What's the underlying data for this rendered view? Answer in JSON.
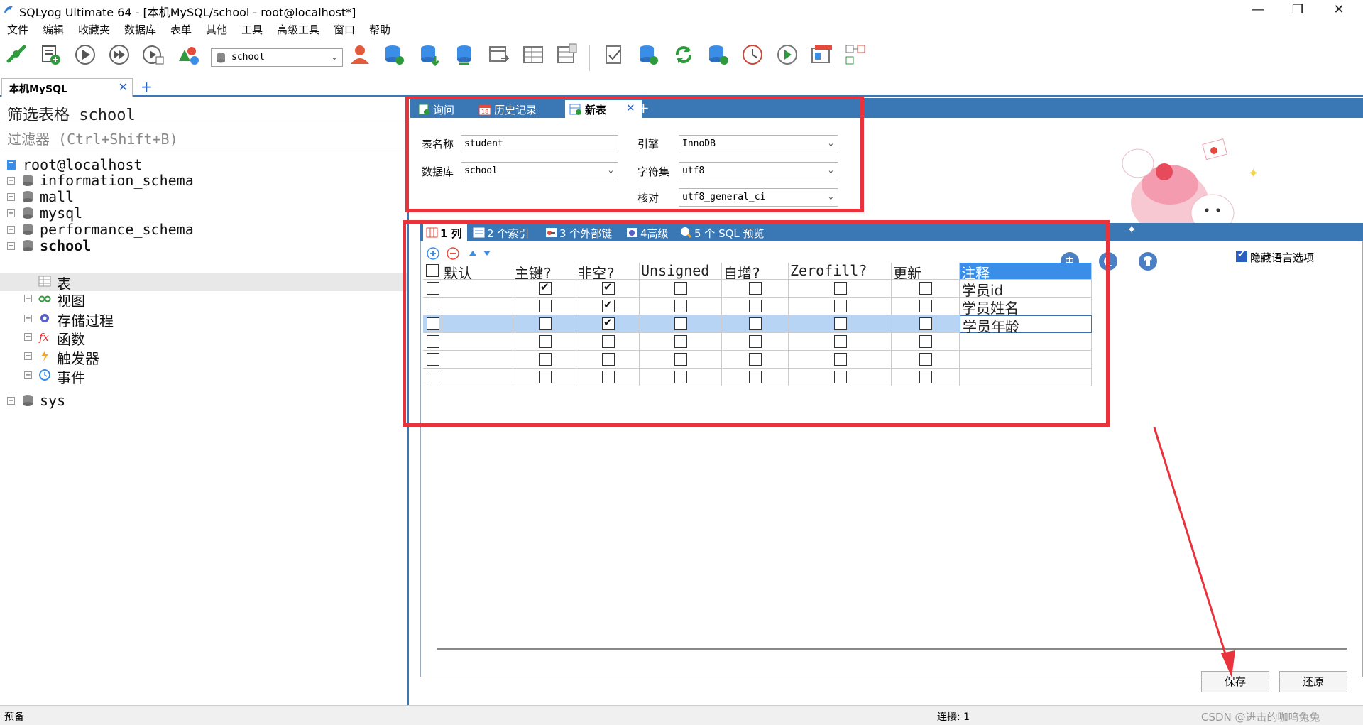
{
  "window": {
    "title": "SQLyog Ultimate 64 - [本机MySQL/school - root@localhost*]",
    "minimize": "—",
    "restore": "❐",
    "close": "✕"
  },
  "menu": [
    "文件",
    "编辑",
    "收藏夹",
    "数据库",
    "表单",
    "其他",
    "工具",
    "高级工具",
    "窗口",
    "帮助"
  ],
  "toolbar": {
    "database_select": "school"
  },
  "connection_tab": {
    "label": "本机MySQL",
    "close": "✕",
    "add": "+"
  },
  "object_browser": {
    "filter_label": "筛选表格 school",
    "filter_hint": "过滤器 (Ctrl+Shift+B)",
    "root": "root@localhost",
    "databases": [
      "information_schema",
      "mall",
      "mysql",
      "performance_schema",
      "school",
      "sys"
    ],
    "school_children": [
      "表",
      "视图",
      "存储过程",
      "函数",
      "触发器",
      "事件"
    ]
  },
  "doc_tabs": {
    "query": "询问",
    "history": "历史记录",
    "new_table": "新表",
    "close": "✕",
    "add": "+"
  },
  "table_form": {
    "name_label": "表名称",
    "name_value": "student",
    "db_label": "数据库",
    "db_value": "school",
    "engine_label": "引擎",
    "engine_value": "InnoDB",
    "charset_label": "字符集",
    "charset_value": "utf8",
    "collation_label": "核对",
    "collation_value": "utf8_general_ci"
  },
  "sub_tabs": {
    "columns": "1 列",
    "indexes": "2 个索引",
    "foreign_keys": "3 个外部键",
    "advanced": "4高级",
    "sql_preview": "5 个 SQL 预览"
  },
  "grid": {
    "headers": [
      "默认",
      "主键?",
      "非空?",
      "Unsigned",
      "自增?",
      "Zerofill?",
      "更新",
      "注释"
    ],
    "rows": [
      {
        "pk": true,
        "notnull": true,
        "unsigned": false,
        "autoinc": false,
        "zerofill": false,
        "update": false,
        "comment": "学员id"
      },
      {
        "pk": false,
        "notnull": true,
        "unsigned": false,
        "autoinc": false,
        "zerofill": false,
        "update": false,
        "comment": "学员姓名"
      },
      {
        "pk": false,
        "notnull": true,
        "unsigned": false,
        "autoinc": false,
        "zerofill": false,
        "update": false,
        "comment": "学员年龄"
      },
      {
        "pk": false,
        "notnull": false,
        "unsigned": false,
        "autoinc": false,
        "zerofill": false,
        "update": false,
        "comment": ""
      },
      {
        "pk": false,
        "notnull": false,
        "unsigned": false,
        "autoinc": false,
        "zerofill": false,
        "update": false,
        "comment": ""
      },
      {
        "pk": false,
        "notnull": false,
        "unsigned": false,
        "autoinc": false,
        "zerofill": false,
        "update": false,
        "comment": ""
      }
    ],
    "selected_row": 3
  },
  "hide_lang_option": "隐藏语言选项",
  "buttons": {
    "save": "保存",
    "restore": "还原"
  },
  "status": {
    "left": "预备",
    "connection": "连接: 1",
    "watermark": "CSDN @进击的咖呜兔兔"
  },
  "colors": {
    "accent": "#3a77b5",
    "header_highlight": "#3b8ee8",
    "selected_row": "#b7d4f5",
    "annotation_red": "#e8323c"
  }
}
